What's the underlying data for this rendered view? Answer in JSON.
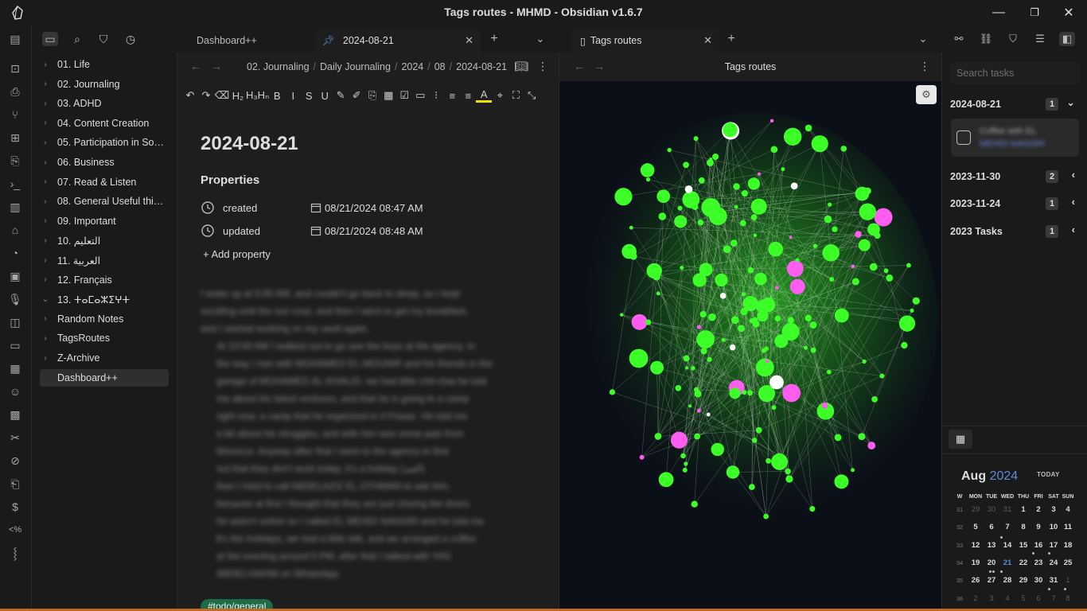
{
  "window": {
    "title": "Tags routes - MHMD - Obsidian v1.6.7",
    "minimize": "—",
    "maximize": "❐",
    "close": "✕"
  },
  "left_sidebar": {
    "tree": [
      {
        "label": "01. Life",
        "type": "folder"
      },
      {
        "label": "02. Journaling",
        "type": "folder"
      },
      {
        "label": "03. ADHD",
        "type": "folder"
      },
      {
        "label": "04. Content Creation",
        "type": "folder"
      },
      {
        "label": "05. Participation in Soci...",
        "type": "folder"
      },
      {
        "label": "06. Business",
        "type": "folder"
      },
      {
        "label": "07. Read & Listen",
        "type": "folder"
      },
      {
        "label": "08. General Useful things",
        "type": "folder"
      },
      {
        "label": "09. Important",
        "type": "folder"
      },
      {
        "label": "التعليم .10",
        "type": "folder"
      },
      {
        "label": "العربية .11",
        "type": "folder"
      },
      {
        "label": "12. Français",
        "type": "folder"
      },
      {
        "label": "13. ⵜⴰⵎⴰⵣⵉⵖⵜ",
        "type": "folder-open"
      },
      {
        "label": "Random Notes",
        "type": "folder"
      },
      {
        "label": "TagsRoutes",
        "type": "folder"
      },
      {
        "label": "Z-Archive",
        "type": "folder"
      },
      {
        "label": "Dashboard++",
        "type": "file",
        "active": true
      }
    ]
  },
  "tabs_left": {
    "tab1": "Dashboard++",
    "tab2": "2024-08-21",
    "new_tab": "+",
    "more": "⌄"
  },
  "tabs_right": {
    "tab1": "Tags routes",
    "new_tab": "+",
    "more": "⌄"
  },
  "editor": {
    "breadcrumb": [
      "02. Journaling",
      "Daily Journaling",
      "2024",
      "08",
      "2024-08-21"
    ],
    "toolbar": [
      "↶",
      "↷",
      "⌫",
      "H₂",
      "H₃Hₙ",
      "B",
      "I",
      "S",
      "U",
      "✎",
      "✐",
      "⎘",
      "▦",
      "☑",
      "▭",
      "⁝",
      "≡",
      "≡",
      "A",
      "⌖",
      "⛶",
      "⤡"
    ],
    "title": "2024-08-21",
    "properties_heading": "Properties",
    "properties": [
      {
        "key": "created",
        "value": "08/21/2024 08:47 AM"
      },
      {
        "key": "updated",
        "value": "08/21/2024 08:48 AM"
      }
    ],
    "add_property": "+ Add property",
    "body_blurred": [
      "I woke up at 5:00 AM, and couldn't go back to sleep, so I kept",
      "scrolling until the sun rose, and then I went to get my breakfast,",
      "and I started working on my vault again.",
      "At 10:00 AM I walked out to go see the boys at the agency. In",
      "the way I met with MOHAMED EL-MOUNIR and his friends in the",
      "garage of MOHAMED AL-KHALID, we had little chit-chat he told",
      "me about his latest ventures, and that he is going to a camp",
      "right now, a camp that he organized in Il Fisaaz. He told me",
      "a bit about his struggles, and with him was some pals from",
      "Morocco. Anyway after that I went to the agency to find",
      "out that they don't work today, it's a holiday (العيد)",
      "then I tried to call ABDELAZIZ EL OTHMAN to ask him,",
      "because at first I thought that they are just closing the doors",
      "he wasn't online so I called EL MEHDI NAGGRI and he told me",
      "it's the holidays, we had a little talk, and we arranged a coffee",
      "at the evening around 5 PM, after that I talked with YAS",
      "ABDELHAKIM on WhatsApp."
    ],
    "tag_bottom": "#todo/general"
  },
  "graph": {
    "title": "Tags routes",
    "menu": "⋮"
  },
  "right_sidebar": {
    "search_placeholder": "Search tasks",
    "groups": [
      {
        "label": "2024-08-21",
        "count": "1",
        "expanded": true
      },
      {
        "label": "2023-11-30",
        "count": "2",
        "expanded": false
      },
      {
        "label": "2023-11-24",
        "count": "1",
        "expanded": false
      },
      {
        "label": "2023 Tasks",
        "count": "1",
        "expanded": false
      }
    ],
    "task_blurred": [
      "Coffee with EL",
      "MEHDI NAGGRI"
    ],
    "calendar": {
      "month": "Aug",
      "year": "2024",
      "today_label": "TODAY",
      "headers": [
        "W",
        "MON",
        "TUE",
        "WED",
        "THU",
        "FRI",
        "SAT",
        "SUN"
      ],
      "weeks": [
        {
          "w": "31",
          "days": [
            "29",
            "30",
            "31",
            "1",
            "2",
            "3",
            "4"
          ]
        },
        {
          "w": "32",
          "days": [
            "5",
            "6",
            "7",
            "8",
            "9",
            "10",
            "11"
          ]
        },
        {
          "w": "33",
          "days": [
            "12",
            "13",
            "14",
            "15",
            "16",
            "17",
            "18"
          ]
        },
        {
          "w": "34",
          "days": [
            "19",
            "20",
            "21",
            "22",
            "23",
            "24",
            "25"
          ]
        },
        {
          "w": "35",
          "days": [
            "26",
            "27",
            "28",
            "29",
            "30",
            "31",
            "1"
          ]
        },
        {
          "w": "36",
          "days": [
            "2",
            "3",
            "4",
            "5",
            "6",
            "7",
            "8"
          ]
        }
      ],
      "today": "21"
    }
  },
  "colors": {
    "accent": "#5b8dd6",
    "graph_node": "#3cff28",
    "graph_pink": "#ff5cf0",
    "tag_pill": "#1f6b46"
  }
}
